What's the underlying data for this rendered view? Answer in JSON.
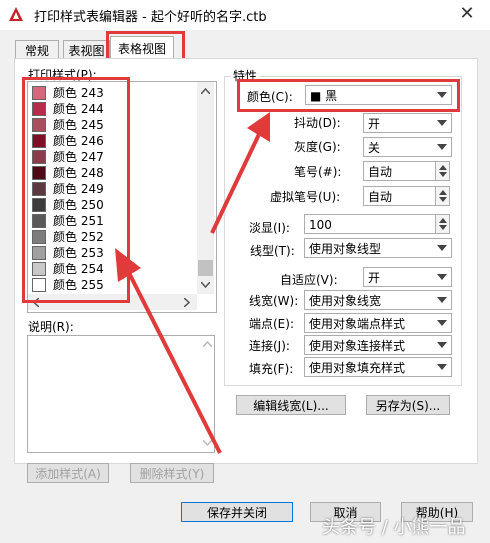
{
  "window": {
    "title": "打印样式表编辑器 - 起个好听的名字.ctb",
    "close_glyph": "✕"
  },
  "tabs": [
    {
      "label": "常规",
      "selected": false
    },
    {
      "label": "表视图",
      "selected": false
    },
    {
      "label": "表格视图",
      "selected": true
    }
  ],
  "left": {
    "print_styles_label": "打印样式(P):",
    "styles": [
      {
        "label": "颜色  243",
        "color": "#d5677d"
      },
      {
        "label": "颜色  244",
        "color": "#b92b4a"
      },
      {
        "label": "颜色  245",
        "color": "#aa4f5f"
      },
      {
        "label": "颜色  246",
        "color": "#7e0f26"
      },
      {
        "label": "颜色  247",
        "color": "#8a3c4d"
      },
      {
        "label": "颜色  248",
        "color": "#4e0a17"
      },
      {
        "label": "颜色  249",
        "color": "#5a3a40"
      },
      {
        "label": "颜色  250",
        "color": "#3c3c3c"
      },
      {
        "label": "颜色  251",
        "color": "#595959"
      },
      {
        "label": "颜色  252",
        "color": "#7d7d7d"
      },
      {
        "label": "颜色  253",
        "color": "#a0a0a0"
      },
      {
        "label": "颜色  254",
        "color": "#c8c8c8"
      },
      {
        "label": "颜色  255",
        "color": "#ffffff"
      }
    ],
    "description_label": "说明(R):",
    "add_style_button": "添加样式(A)",
    "delete_style_button": "删除样式(Y)"
  },
  "properties": {
    "group_label": "特性",
    "color_label": "颜色(C):",
    "color_value": "■ 黑",
    "dither_label": "抖动(D):",
    "dither_value": "开",
    "grayscale_label": "灰度(G):",
    "grayscale_value": "关",
    "pen_label": "笔号(#):",
    "pen_value": "自动",
    "virtual_pen_label": "虚拟笔号(U):",
    "virtual_pen_value": "自动",
    "screening_label": "淡显(I):",
    "screening_value": "100",
    "linetype_label": "线型(T):",
    "linetype_value": "使用对象线型",
    "adaptive_label": "自适应(V):",
    "adaptive_value": "开",
    "lineweight_label": "线宽(W):",
    "lineweight_value": "使用对象线宽",
    "endstyle_label": "端点(E):",
    "endstyle_value": "使用对象端点样式",
    "joinstyle_label": "连接(J):",
    "joinstyle_value": "使用对象连接样式",
    "fillstyle_label": "填充(F):",
    "fillstyle_value": "使用对象填充样式",
    "edit_lineweights_button": "编辑线宽(L)...",
    "save_as_button": "另存为(S)..."
  },
  "footer": {
    "save_close_button": "保存并关闭",
    "cancel_button": "取消",
    "help_button": "帮助(H)",
    "watermark": "头条号 / 小熊一品"
  },
  "colors": {
    "highlight_red": "#e03a3a",
    "accent_blue": "#0078d7"
  }
}
